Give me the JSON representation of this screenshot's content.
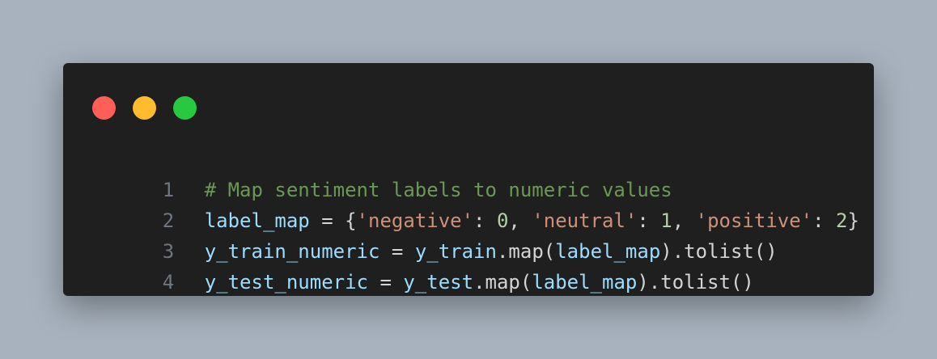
{
  "window": {
    "controls": [
      {
        "name": "close",
        "color": "#ff5f57"
      },
      {
        "name": "minimize",
        "color": "#febc2e"
      },
      {
        "name": "maximize",
        "color": "#28c840"
      }
    ]
  },
  "code": {
    "lines": [
      {
        "number": "1",
        "tokens": [
          {
            "t": "# Map sentiment labels to numeric values",
            "c": "cmt"
          }
        ]
      },
      {
        "number": "2",
        "tokens": [
          {
            "t": "label_map",
            "c": "var"
          },
          {
            "t": " = {",
            "c": "txt"
          },
          {
            "t": "'negative'",
            "c": "str"
          },
          {
            "t": ": ",
            "c": "txt"
          },
          {
            "t": "0",
            "c": "num"
          },
          {
            "t": ", ",
            "c": "txt"
          },
          {
            "t": "'neutral'",
            "c": "str"
          },
          {
            "t": ": ",
            "c": "txt"
          },
          {
            "t": "1",
            "c": "num"
          },
          {
            "t": ", ",
            "c": "txt"
          },
          {
            "t": "'positive'",
            "c": "str"
          },
          {
            "t": ": ",
            "c": "txt"
          },
          {
            "t": "2",
            "c": "num"
          },
          {
            "t": "}",
            "c": "txt"
          }
        ]
      },
      {
        "number": "3",
        "tokens": [
          {
            "t": "y_train_numeric",
            "c": "var"
          },
          {
            "t": " = ",
            "c": "txt"
          },
          {
            "t": "y_train",
            "c": "var"
          },
          {
            "t": ".map(",
            "c": "txt"
          },
          {
            "t": "label_map",
            "c": "var"
          },
          {
            "t": ").tolist()",
            "c": "txt"
          }
        ]
      },
      {
        "number": "4",
        "tokens": [
          {
            "t": "y_test_numeric",
            "c": "var"
          },
          {
            "t": " = ",
            "c": "txt"
          },
          {
            "t": "y_test",
            "c": "var"
          },
          {
            "t": ".map(",
            "c": "txt"
          },
          {
            "t": "label_map",
            "c": "var"
          },
          {
            "t": ").tolist()",
            "c": "txt"
          }
        ]
      }
    ]
  }
}
